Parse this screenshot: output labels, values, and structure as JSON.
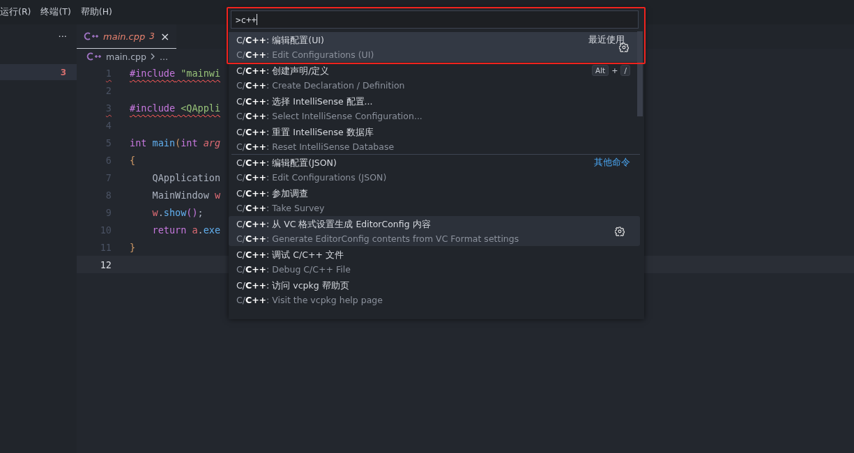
{
  "menu_bar": [
    "运行(R)",
    "终端(T)",
    "帮助(H)"
  ],
  "sidebar": {
    "more": "···",
    "rows": [
      {
        "badge": "3",
        "selected": true
      }
    ]
  },
  "tab": {
    "name": "main.cpp",
    "problems": "3",
    "close": "×",
    "selected": true
  },
  "breadcrumb": [
    "main.cpp",
    "..."
  ],
  "code": [
    {
      "number": "1",
      "squiggle": true,
      "current": false,
      "tokens": [
        {
          "kind": "keyword",
          "text": "#include"
        },
        {
          "kind": "string",
          "text": " \"mainwi"
        }
      ]
    },
    {
      "number": "2",
      "squiggle": false,
      "current": false
    },
    {
      "number": "3",
      "squiggle": true,
      "current": false,
      "tokens": [
        {
          "kind": "keyword",
          "text": "#include"
        },
        {
          "kind": "string",
          "text": " <QAppli"
        }
      ]
    },
    {
      "number": "4",
      "squiggle": false,
      "current": false
    },
    {
      "number": "5",
      "squiggle": false,
      "current": false,
      "tokens": [
        {
          "kind": "keyword",
          "text": "int"
        },
        {
          "kind": "func",
          "text": " main"
        },
        {
          "kind": "paren",
          "text": "("
        },
        {
          "kind": "keyword",
          "text": "int"
        },
        {
          "kind": "param",
          "text": " arg"
        }
      ]
    },
    {
      "number": "6",
      "squiggle": false,
      "current": false,
      "tokens": [
        {
          "kind": "paren",
          "text": "{"
        }
      ]
    },
    {
      "number": "7",
      "squiggle": false,
      "current": false,
      "tokens": [
        {
          "kind": "plain",
          "text": "    QApplication"
        }
      ]
    },
    {
      "number": "8",
      "squiggle": false,
      "current": false,
      "tokens": [
        {
          "kind": "plain",
          "text": "    MainWindow"
        },
        {
          "kind": "var",
          "text": " w"
        }
      ]
    },
    {
      "number": "9",
      "squiggle": false,
      "current": false,
      "tokens": [
        {
          "kind": "var",
          "text": "    w"
        },
        {
          "kind": "plain",
          "text": "."
        },
        {
          "kind": "func",
          "text": "show"
        },
        {
          "kind": "bracket",
          "text": "()"
        },
        {
          "kind": "plain",
          "text": ";"
        }
      ]
    },
    {
      "number": "10",
      "squiggle": false,
      "current": false,
      "tokens": [
        {
          "kind": "keyword",
          "text": "    return"
        },
        {
          "kind": "var",
          "text": " a"
        },
        {
          "kind": "plain",
          "text": "."
        },
        {
          "kind": "func",
          "text": "exe"
        }
      ]
    },
    {
      "number": "11",
      "squiggle": false,
      "current": false,
      "tokens": [
        {
          "kind": "paren",
          "text": "}"
        }
      ]
    },
    {
      "number": "12",
      "squiggle": false,
      "current": true
    }
  ],
  "command_palette": {
    "input": ">c++",
    "items": [
      {
        "title": "C/**C++**: 编辑配置(UI)",
        "subtitle": "C/**C++**: Edit Configurations (UI)",
        "label": "最近使用",
        "separator_above": false,
        "selected": true,
        "hovered": false
      },
      {
        "title": "C/**C++**: 创建声明/定义",
        "subtitle": "C/**C++**: Create Declaration / Definition",
        "separator_above": false,
        "keys": [
          "Alt",
          "/"
        ],
        "key_joiner": "+",
        "selected": false,
        "hovered": false
      },
      {
        "title": "C/**C++**: 选择 IntelliSense 配置...",
        "subtitle": "C/**C++**: Select IntelliSense Configuration...",
        "separator_above": false,
        "selected": false,
        "hovered": false
      },
      {
        "title": "C/**C++**: 重置 IntelliSense 数据库",
        "subtitle": "C/**C++**: Reset IntelliSense Database",
        "separator_above": false,
        "selected": false,
        "hovered": false
      },
      {
        "title": "C/**C++**: 编辑配置(JSON)",
        "subtitle": "C/**C++**: Edit Configurations (JSON)",
        "link": "其他命令",
        "separator_above": true,
        "selected": false,
        "hovered": false
      },
      {
        "title": "C/**C++**: 参加调查",
        "subtitle": "C/**C++**: Take Survey",
        "separator_above": false,
        "selected": false,
        "hovered": false
      },
      {
        "title": "C/**C++**: 从 VC 格式设置生成 EditorConfig 内容",
        "subtitle": "C/**C++**: Generate EditorConfig contents from VC Format settings",
        "separator_above": false,
        "selected": false,
        "hovered": true
      },
      {
        "title": "C/**C++**: 调试 C/C++ 文件",
        "subtitle": "C/**C++**: Debug C/C++ File",
        "separator_above": false,
        "selected": false,
        "hovered": false
      },
      {
        "title": "C/**C++**: 访问 vcpkg 帮助页",
        "subtitle": "C/**C++**: Visit the vcpkg help page",
        "separator_above": false,
        "selected": false,
        "hovered": false
      }
    ]
  }
}
